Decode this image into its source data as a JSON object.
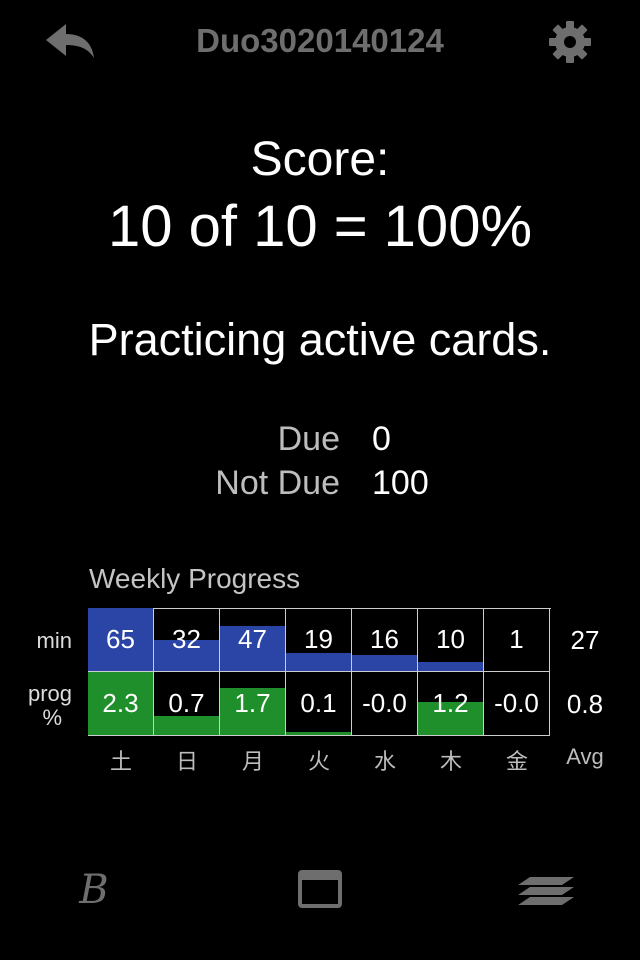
{
  "header": {
    "title": "Duo3020140124"
  },
  "score": {
    "label": "Score:",
    "value": "10 of 10 = 100%"
  },
  "mode": "Practicing active cards.",
  "stats": [
    {
      "label": "Due",
      "value": "0"
    },
    {
      "label": "Not Due",
      "value": "100"
    }
  ],
  "weekly": {
    "title": "Weekly Progress",
    "row_labels": {
      "min": "min",
      "prog_line1": "prog",
      "prog_line2": "%"
    },
    "days": [
      "土",
      "日",
      "月",
      "火",
      "水",
      "木",
      "金"
    ],
    "avg_label": "Avg",
    "min_values": [
      "65",
      "32",
      "47",
      "19",
      "16",
      "10",
      "1"
    ],
    "min_fill_fraction": [
      1.0,
      0.49,
      0.72,
      0.29,
      0.25,
      0.15,
      0.0
    ],
    "min_avg": "27",
    "prog_values": [
      "2.3",
      "0.7",
      "1.7",
      "0.1",
      "-0.0",
      "1.2",
      "-0.0"
    ],
    "prog_fill_fraction": [
      1.0,
      0.3,
      0.74,
      0.04,
      0.0,
      0.52,
      0.0
    ],
    "prog_avg": "0.8"
  },
  "colors": {
    "min_bar": "#2a45a6",
    "prog_bar": "#1e8f2a",
    "title_gray": "#6e6e6e"
  },
  "toolbar": {
    "icons": [
      "script-b-icon",
      "card-icon",
      "stack-icon"
    ]
  }
}
